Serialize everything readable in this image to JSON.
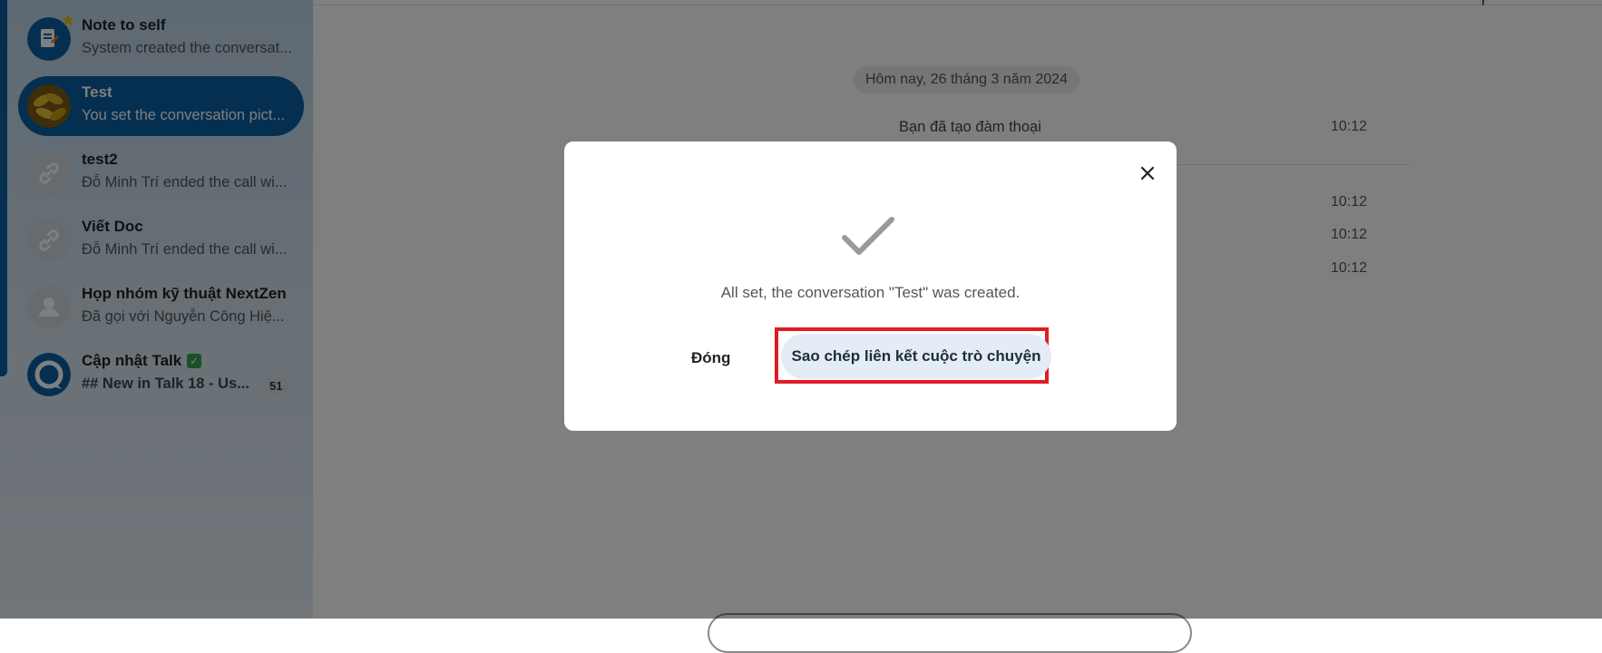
{
  "sidebar": {
    "conversations": [
      {
        "title": "Note to self",
        "subtitle": "System created the conversat...",
        "icon": "note-icon"
      },
      {
        "title": "Test",
        "subtitle": "You set the conversation pict...",
        "icon": "bananas-avatar"
      },
      {
        "title": "test2",
        "subtitle": "Đỗ Minh Trí ended the call wi...",
        "icon": "link-icon"
      },
      {
        "title": "Viết Doc",
        "subtitle": "Đỗ Minh Trí ended the call wi...",
        "icon": "link-icon"
      },
      {
        "title": "Họp nhóm kỹ thuật NextZen",
        "subtitle": "Đã gọi với Nguyễn Công Hiệ...",
        "icon": "user-icon"
      },
      {
        "title": "Cập nhật Talk",
        "subtitle": "## New in Talk 18 - Us...",
        "icon": "talk-logo-icon",
        "badge_count": "51"
      }
    ]
  },
  "chat": {
    "date_separator": "Hôm nay, 26 tháng 3 năm 2024",
    "system_message": "Bạn đã tạo đàm thoại",
    "times": [
      "10:12",
      "10:12",
      "10:12",
      "10:12"
    ]
  },
  "modal": {
    "message": "All set, the conversation \"Test\" was created.",
    "close_label": "Đóng",
    "copy_link_label": "Sao chép liên kết cuộc trò chuyện"
  },
  "colors": {
    "accent": "#0a5fa0",
    "highlight_border": "#e01b24",
    "copy_button_bg": "#e4ecf5"
  }
}
